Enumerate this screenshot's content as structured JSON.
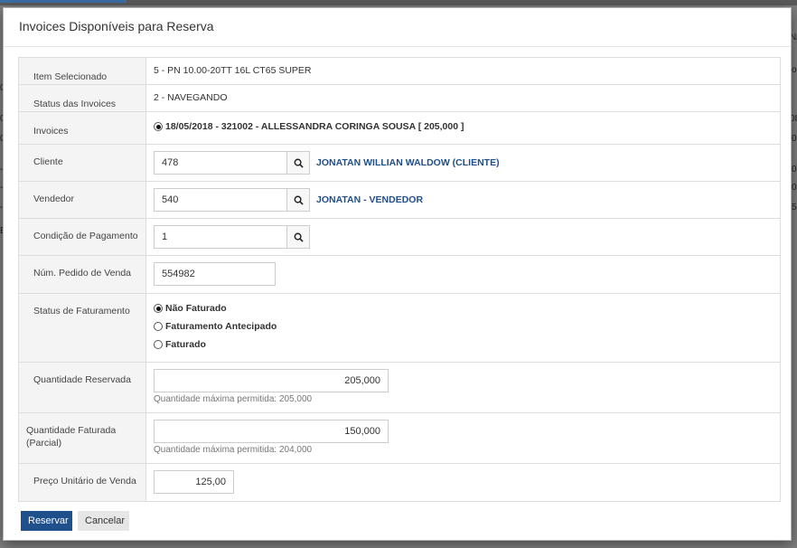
{
  "background": {
    "right_fragments": [
      "NA",
      "o",
      "08",
      "0",
      "0",
      "0",
      "5"
    ],
    "left_fragments": [
      "0-",
      "0-",
      "0-",
      "-2",
      "-2",
      "-2",
      "E"
    ]
  },
  "modal": {
    "title": "Invoices Disponíveis para Reserva"
  },
  "fields": {
    "item_selecionado": {
      "label": "Item Selecionado",
      "value": "5 - PN 10.00-20TT 16L CT65 SUPER"
    },
    "status_invoices": {
      "label": "Status das Invoices",
      "value": "2 - NAVEGANDO"
    },
    "invoices": {
      "label": "Invoices",
      "option": "18/05/2018 - 321002 - ALLESSANDRA CORINGA SOUSA [ 205,000 ]"
    },
    "cliente": {
      "label": "Cliente",
      "value": "478",
      "name": "JONATAN WILLIAN WALDOW (CLIENTE)"
    },
    "vendedor": {
      "label": "Vendedor",
      "value": "540",
      "name": "JONATAN - VENDEDOR"
    },
    "condicao_pagamento": {
      "label": "Condição de Pagamento",
      "value": "1"
    },
    "pedido_venda": {
      "label": "Núm. Pedido de Venda",
      "value": "554982"
    },
    "status_faturamento": {
      "label": "Status de Faturamento",
      "options": [
        "Não Faturado",
        "Faturamento Antecipado",
        "Faturado"
      ],
      "selected": "Não Faturado"
    },
    "quantidade_reservada": {
      "label": "Quantidade Reservada",
      "value": "205,000",
      "help": "Quantidade máxima permitida: 205,000"
    },
    "quantidade_faturada": {
      "label": "Quantidade Faturada (Parcial)",
      "value": "150,000",
      "help": "Quantidade máxima permitida: 204,000"
    },
    "preco_unitario": {
      "label": "Preço Unitário de Venda",
      "value": "125,00"
    }
  },
  "buttons": {
    "reservar": "Reservar",
    "cancelar": "Cancelar"
  }
}
